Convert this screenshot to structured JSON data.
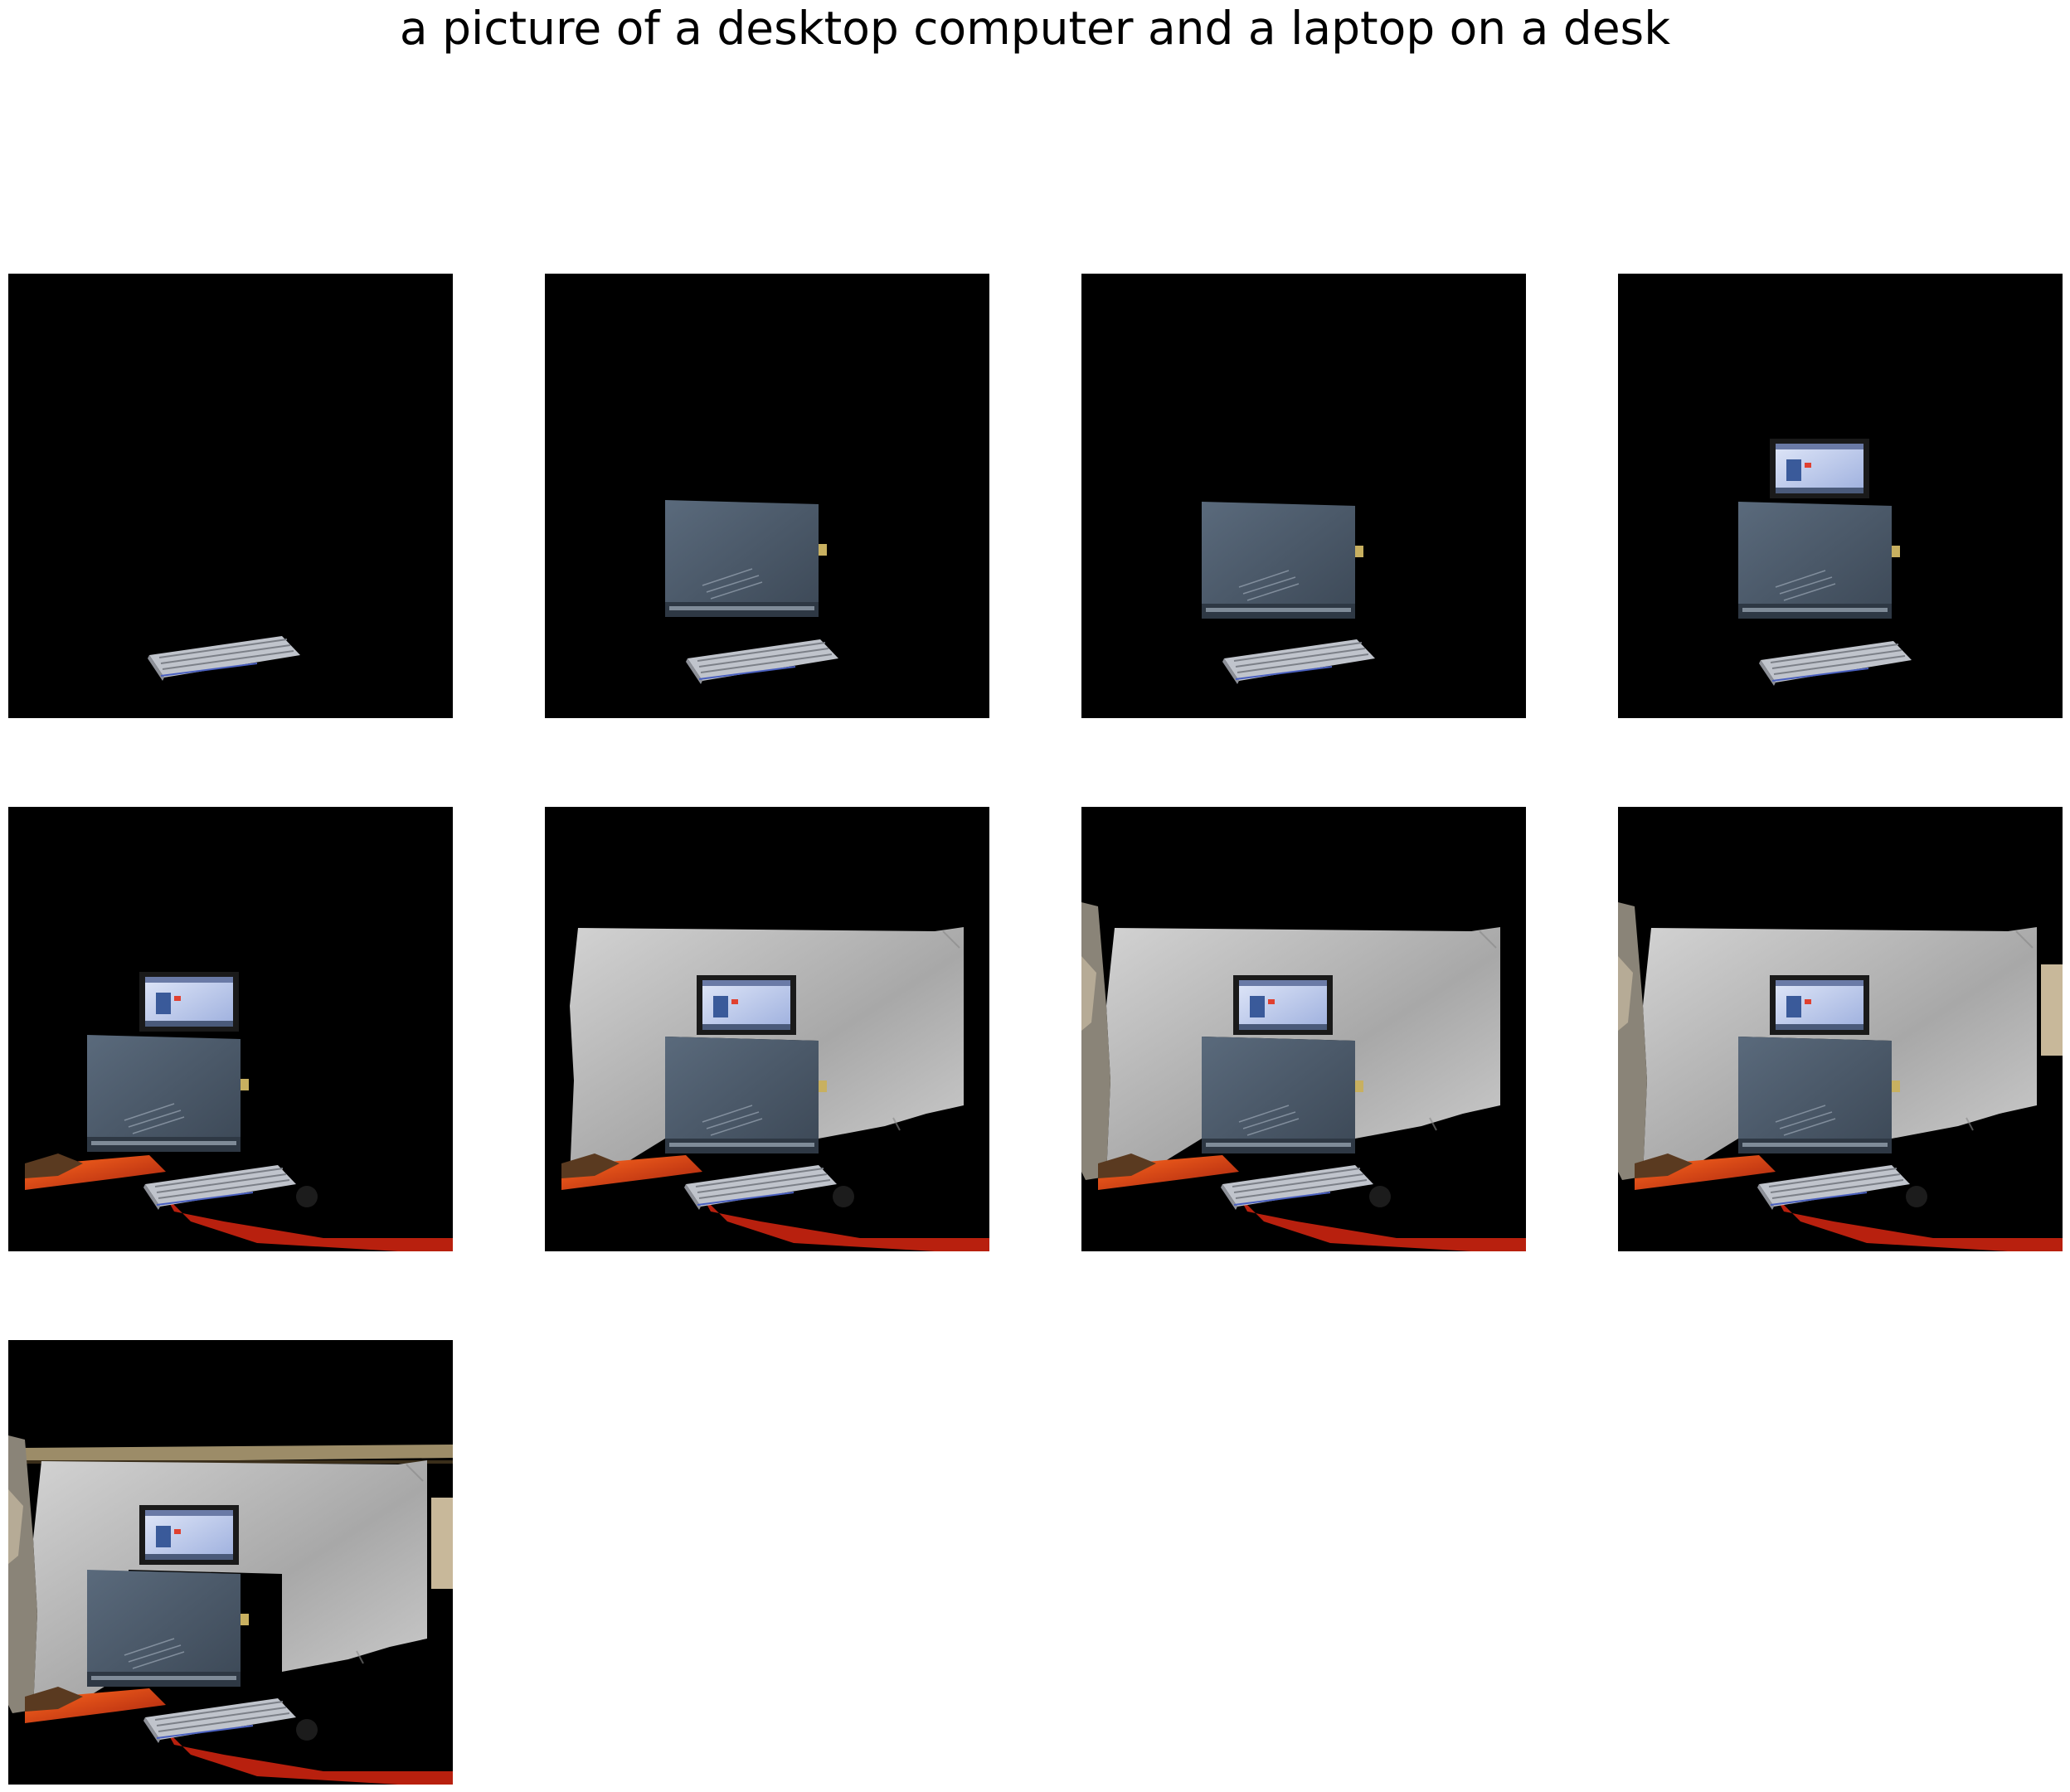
{
  "figure": {
    "title": "a picture of a desktop computer and a laptop on a desk"
  },
  "panels": [
    {
      "visible_objects": [
        "keyboard"
      ]
    },
    {
      "visible_objects": [
        "keyboard",
        "computer-case"
      ]
    },
    {
      "visible_objects": [
        "keyboard",
        "computer-case"
      ]
    },
    {
      "visible_objects": [
        "keyboard",
        "computer-case",
        "laptop"
      ]
    },
    {
      "visible_objects": [
        "keyboard",
        "computer-case",
        "laptop",
        "desk"
      ]
    },
    {
      "visible_objects": [
        "keyboard",
        "computer-case",
        "laptop",
        "desk",
        "wall"
      ]
    },
    {
      "visible_objects": [
        "keyboard",
        "computer-case",
        "laptop",
        "desk",
        "wall",
        "left-wall-edge"
      ]
    },
    {
      "visible_objects": [
        "keyboard",
        "computer-case",
        "laptop",
        "desk",
        "wall",
        "left-wall-edge",
        "right-wall-edge"
      ]
    },
    {
      "visible_objects": [
        "keyboard",
        "computer-case",
        "laptop",
        "desk",
        "wall",
        "left-wall-edge",
        "right-wall-edge",
        "ceiling-strip"
      ]
    }
  ],
  "colors": {
    "background": "#000000",
    "keyboard": "#b8bcc4",
    "computer_case": "#4a5868",
    "laptop_screen": "#c8d4f0",
    "desk": "#e0481a",
    "wall": "#b4b4b4",
    "ceiling": "#9a8a6a"
  }
}
